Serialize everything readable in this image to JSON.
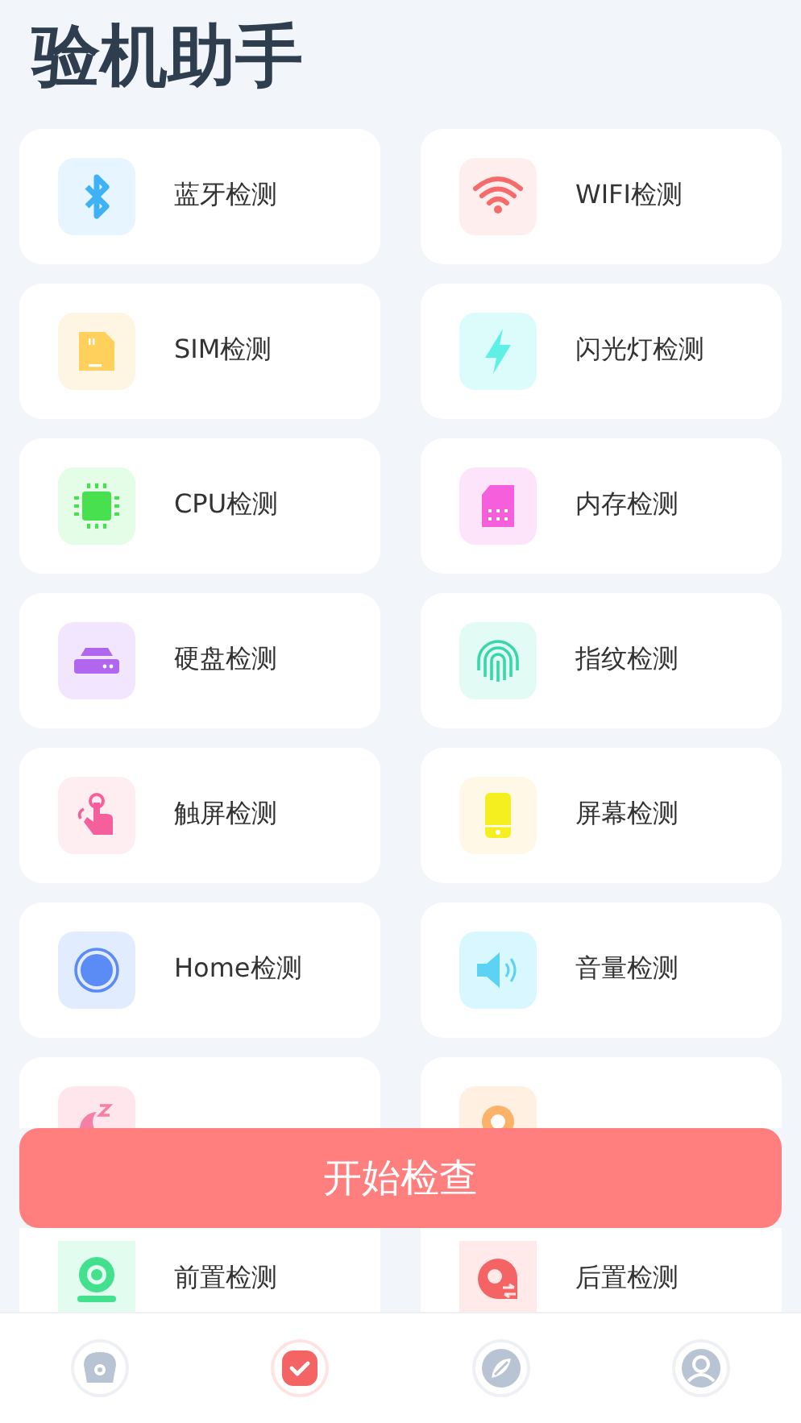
{
  "title": "验机助手",
  "items": [
    {
      "label": "蓝牙检测",
      "kind": "bluetooth"
    },
    {
      "label": "WIFI检测",
      "kind": "wifi"
    },
    {
      "label": "SIM检测",
      "kind": "sim"
    },
    {
      "label": "闪光灯检测",
      "kind": "flash"
    },
    {
      "label": "CPU检测",
      "kind": "cpu"
    },
    {
      "label": "内存检测",
      "kind": "memory"
    },
    {
      "label": "硬盘检测",
      "kind": "disk"
    },
    {
      "label": "指纹检测",
      "kind": "fingerprint"
    },
    {
      "label": "触屏检测",
      "kind": "touch"
    },
    {
      "label": "屏幕检测",
      "kind": "screen"
    },
    {
      "label": "Home检测",
      "kind": "home"
    },
    {
      "label": "音量检测",
      "kind": "volume"
    }
  ],
  "items_behind_button": [
    {
      "kind": "sleep"
    },
    {
      "kind": "location"
    }
  ],
  "start_button": "开始检查",
  "items_below_button": [
    {
      "label": "前置检测",
      "kind": "front-camera"
    },
    {
      "label": "后置检测",
      "kind": "rear-camera"
    }
  ],
  "tabs": [
    {
      "kind": "device",
      "selected": false
    },
    {
      "kind": "check",
      "selected": true
    },
    {
      "kind": "discover",
      "selected": false
    },
    {
      "kind": "profile",
      "selected": false
    }
  ]
}
